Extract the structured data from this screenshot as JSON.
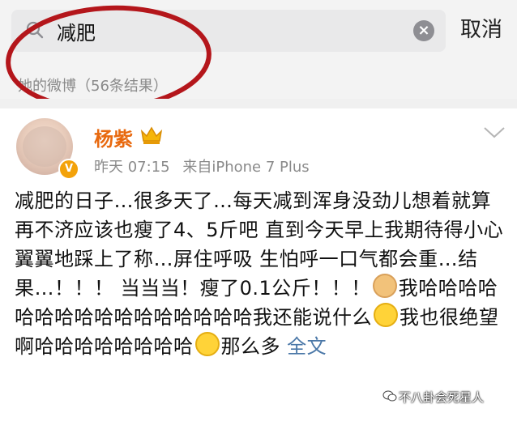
{
  "search": {
    "query": "减肥",
    "cancel_label": "取消",
    "results_label": "她的微博（56条结果）"
  },
  "post": {
    "author": "杨紫",
    "verified_badge": "V",
    "time": "昨天 07:15",
    "source": "来自iPhone 7 Plus",
    "body_segments": [
      "减肥的日子…很多天了…每天减到浑身没劲儿想着就算再不济应该也瘦了4、5斤吧 直到今天早上我期待得小心翼翼地踩上了称…屏住呼吸 生怕呼一口气都会重…结果…！！！ 当当当！瘦了0.1公斤！！！",
      "我哈哈哈哈哈哈哈哈哈哈哈哈哈哈哈哈我还能说什么",
      "我也很绝望啊哈哈哈哈哈哈哈哈",
      "那么多"
    ],
    "full_text_label": "全文"
  },
  "watermark": "不八卦会死星人",
  "colors": {
    "accent_name": "#e8690f",
    "link": "#4b78a8",
    "highlight": "#b4161b"
  },
  "icons": [
    "search-icon",
    "clear-icon",
    "crown-icon",
    "chevron-down-icon",
    "cat-emoji",
    "shrug-emoji",
    "wechat-icon"
  ]
}
